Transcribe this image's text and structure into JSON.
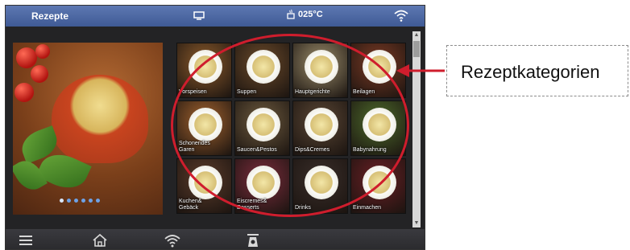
{
  "status_bar": {
    "title": "Rezepte",
    "temperature": "025°C",
    "icons": [
      "screen-icon",
      "pot-icon",
      "wifi-icon"
    ]
  },
  "hero": {
    "image": "soup-in-pot-photo",
    "carousel_dots_total": 6,
    "carousel_active_index": 0
  },
  "categories": [
    {
      "label": "Vorspeisen",
      "tile_color": "#8b5a2b"
    },
    {
      "label": "Suppen",
      "tile_color": "#6b4a2a"
    },
    {
      "label": "Hauptgerichte",
      "tile_color": "#9a8c6a"
    },
    {
      "label": "Beilagen",
      "tile_color": "#7b3a24"
    },
    {
      "label": "Schonendes\nGaren",
      "tile_color": "#a2622e"
    },
    {
      "label": "Saucen&Pestos",
      "tile_color": "#6d5a3e"
    },
    {
      "label": "Dips&Cremes",
      "tile_color": "#5a4634"
    },
    {
      "label": "Babynahrung",
      "tile_color": "#4d6a2b"
    },
    {
      "label": "Kuchen&\nGebäck",
      "tile_color": "#5b3b2a"
    },
    {
      "label": "Eiscremes&\nDesserts",
      "tile_color": "#7b2c3c"
    },
    {
      "label": "Drinks",
      "tile_color": "#3a2e2a"
    },
    {
      "label": "Einmachen",
      "tile_color": "#6a1f24"
    }
  ],
  "bottom_bar": {
    "icons": [
      "menu-icon",
      "home-icon",
      "wifi-icon",
      "scale-icon"
    ]
  },
  "annotation": {
    "label": "Rezeptkategorien",
    "color": "#cf1d2d"
  }
}
